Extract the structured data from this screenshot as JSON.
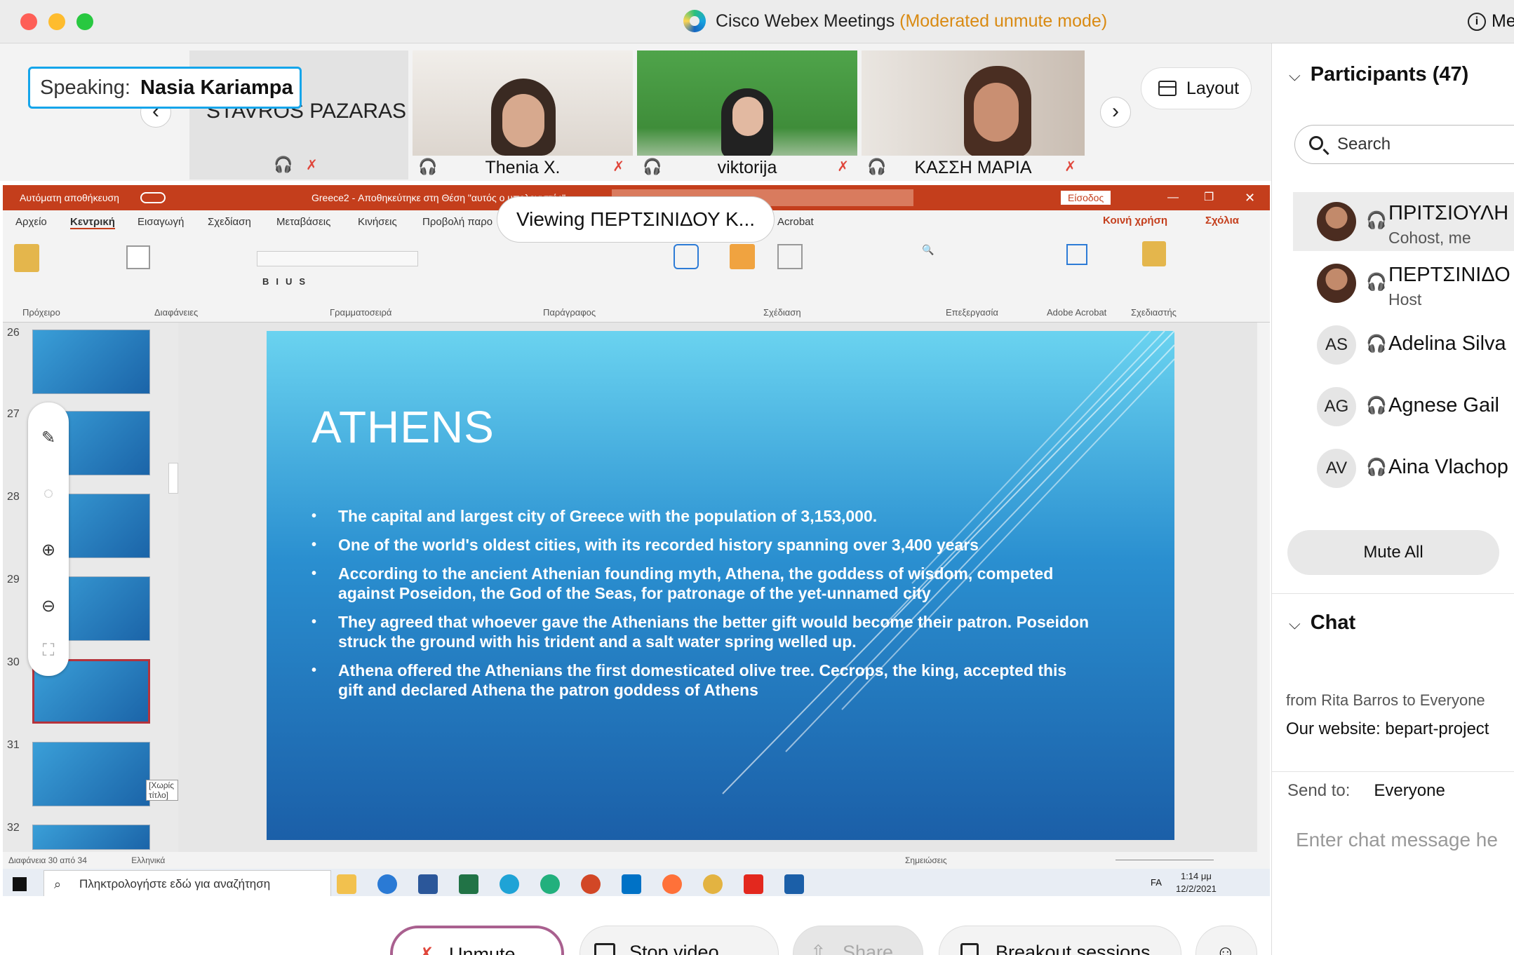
{
  "window": {
    "title": "Cisco Webex Meetings",
    "mode": "(Moderated unmute mode)",
    "corner_label": "Me"
  },
  "strip": {
    "speaking_label": "Speaking:",
    "speaking_name": "Nasia Kariampa",
    "stavros_name": "STAVROS PAZARAS",
    "tiles": [
      {
        "name": "Thenia X."
      },
      {
        "name": "viktorija"
      },
      {
        "name": "ΚΑΣΣΗ ΜΑΡΙΑ"
      }
    ],
    "layout_label": "Layout"
  },
  "share": {
    "viewing": "Viewing ΠΕΡΤΣΙΝΙΔΟΥ Κ...",
    "ppt_title_left": "Αυτόματη αποθήκευση",
    "ppt_title_doc": "Greece2 - Αποθηκεύτηκε στη Θέση \"αυτός ο υπολογιστής\"",
    "ppt_signin": "Είσοδος",
    "tabs": [
      "Αρχείο",
      "Κεντρική",
      "Εισαγωγή",
      "Σχεδίαση",
      "Μεταβάσεις",
      "Κινήσεις",
      "Προβολή παρο",
      "Acrobat"
    ],
    "share_btn": "Κοινή χρήση",
    "comments_btn": "Σχόλια",
    "ribbon_groups": [
      "Πρόχειρο",
      "Διαφάνειες",
      "Γραμματοσειρά",
      "Παράγραφος",
      "Σχέδιαση",
      "Επεξεργασία",
      "Adobe Acrobat",
      "Σχεδιαστής"
    ],
    "thumb_numbers": [
      "26",
      "27",
      "28",
      "29",
      "30",
      "31",
      "32"
    ],
    "thumb_tooltip": "[Χωρίς τίτλο]",
    "slide": {
      "title": "ATHENS",
      "bullets": [
        "The capital and largest city of Greece with the population of 3,153,000.",
        "One of the world's oldest cities, with its recorded history spanning over 3,400 years",
        "According to the ancient Athenian founding myth, Athena, the goddess of wisdom, competed against Poseidon, the God of the Seas, for patronage of the yet-unnamed city",
        "They agreed that whoever gave the Athenians the better gift would become their patron. Poseidon struck the ground with his trident and a salt water spring welled up.",
        "Athena offered the Athenians the first domesticated olive tree. Cecrops, the king, accepted this gift and declared Athena the patron goddess of Athens"
      ]
    },
    "status_left": "Διαφάνεια 30 από 34",
    "status_lang": "Ελληνικά",
    "status_notes": "Σημειώσεις",
    "taskbar_search": "Πληκτρολογήστε εδώ για αναζήτηση",
    "clock_time": "1:14 μμ",
    "clock_date": "12/2/2021",
    "taskbar_lang": "FA"
  },
  "controls": {
    "unmute": "Unmute",
    "stop_video": "Stop video",
    "share": "Share",
    "breakout": "Breakout sessions"
  },
  "panel": {
    "participants_title": "Participants (47)",
    "search_placeholder": "Search",
    "participants": [
      {
        "name": "ΠΡΙΤΣΙΟΥΛΗ",
        "role": "Cohost, me"
      },
      {
        "name": "ΠΕΡΤΣΙΝΙΔΟ",
        "role": "Host"
      },
      {
        "initials": "AS",
        "name": "Adelina Silva"
      },
      {
        "initials": "AG",
        "name": "Agnese Gail"
      },
      {
        "initials": "AV",
        "name": "Aina Vlachop"
      }
    ],
    "mute_all": "Mute All",
    "chat_title": "Chat",
    "chat_from": "from Rita Barros to Everyone",
    "chat_message": "Our website: bepart-project",
    "send_to_label": "Send to:",
    "send_to_value": "Everyone",
    "chat_placeholder": "Enter chat message he"
  }
}
